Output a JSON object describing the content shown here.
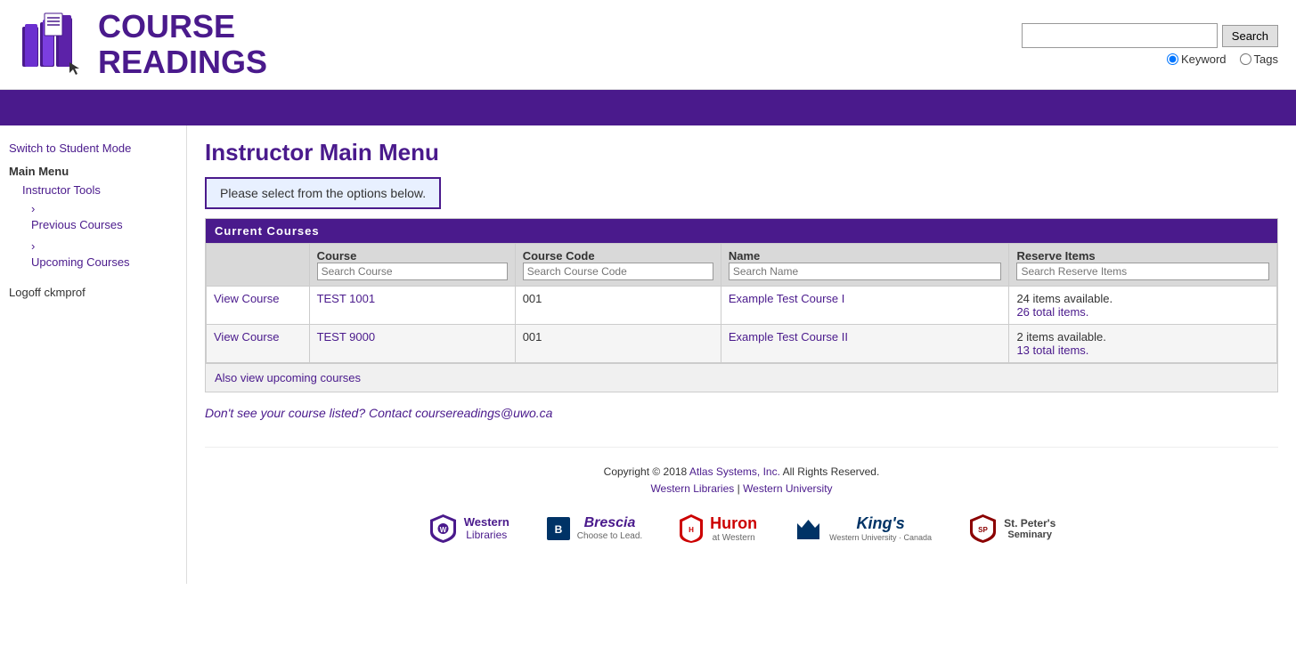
{
  "header": {
    "logo_line1": "COURSE",
    "logo_line2": "READINGS",
    "search_button": "Search",
    "search_placeholder": "",
    "keyword_label": "Keyword",
    "tags_label": "Tags"
  },
  "sidebar": {
    "switch_mode": "Switch to Student Mode",
    "main_menu": "Main Menu",
    "instructor_tools": "Instructor Tools",
    "previous_courses": "Previous Courses",
    "upcoming_courses": "Upcoming Courses",
    "logoff": "Logoff ckmprof"
  },
  "page": {
    "title": "Instructor Main Menu",
    "info_message": "Please select from the options below.",
    "section_title": "Current Courses"
  },
  "table": {
    "columns": [
      "",
      "Course",
      "Course Code",
      "Name",
      "Reserve Items"
    ],
    "search_placeholders": {
      "course": "Search Course",
      "course_code": "Search Course Code",
      "name": "Search Name",
      "reserve_items": "Search Reserve Items"
    },
    "rows": [
      {
        "action": "View Course",
        "course": "TEST 1001",
        "code": "001",
        "name": "Example Test Course I",
        "items_available": "24 items available.",
        "items_total": "26 total items."
      },
      {
        "action": "View Course",
        "course": "TEST 9000",
        "code": "001",
        "name": "Example Test Course II",
        "items_available": "2 items available.",
        "items_total": "13 total items."
      }
    ],
    "also_view": "Also view upcoming courses"
  },
  "contact": {
    "text": "Don't see your course listed? Contact coursereadings@uwo.ca"
  },
  "footer": {
    "copyright": "Copyright © 2018",
    "company": "Atlas Systems, Inc.",
    "rights": "All Rights Reserved.",
    "link1": "Western Libraries",
    "link2": "Western University",
    "logos": [
      {
        "name": "Western Libraries",
        "id": "western"
      },
      {
        "name": "Brescia\nChoose to Lead.",
        "id": "brescia"
      },
      {
        "name": "Huron\nat Western",
        "id": "huron"
      },
      {
        "name": "King's\nWestern University · Canada",
        "id": "kings"
      },
      {
        "name": "St. Peter's\nSeminary",
        "id": "stpeters"
      }
    ]
  }
}
